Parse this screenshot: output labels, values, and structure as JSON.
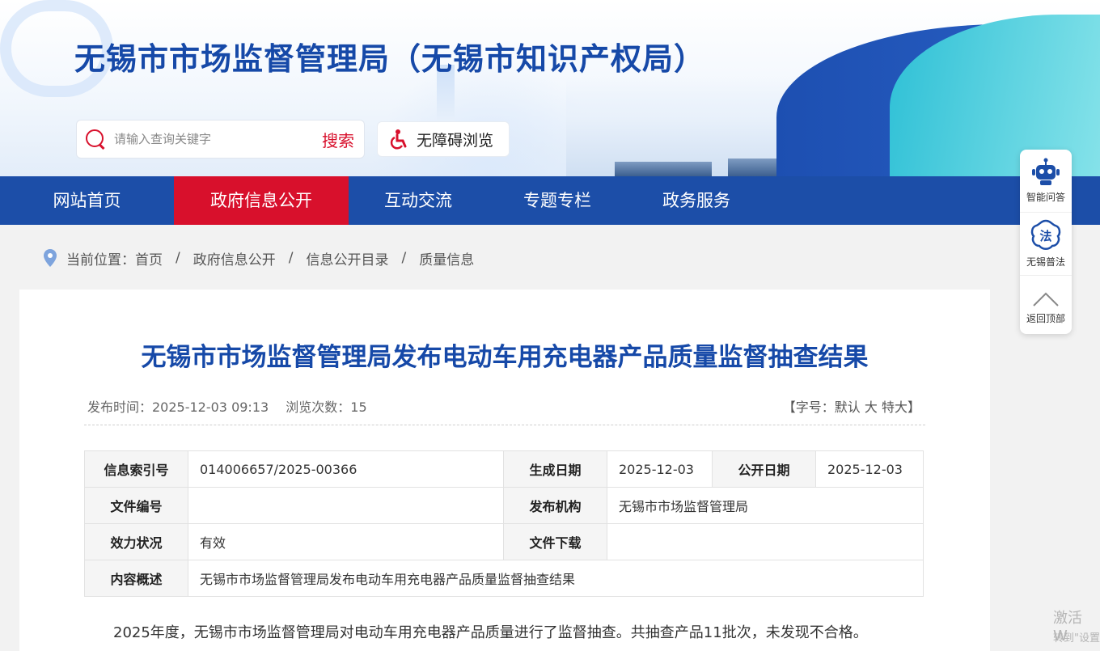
{
  "header": {
    "site_title": "无锡市市场监督管理局（无锡市知识产权局）",
    "search_placeholder": "请输入查询关键字",
    "search_button": "搜索",
    "accessibility_button": "无障碍浏览"
  },
  "nav": {
    "items": [
      {
        "label": "网站首页"
      },
      {
        "label": "政府信息公开"
      },
      {
        "label": "互动交流"
      },
      {
        "label": "专题专栏"
      },
      {
        "label": "政务服务"
      }
    ],
    "active_index": 1
  },
  "breadcrumb": {
    "prefix": "当前位置：",
    "items": [
      "首页",
      "政府信息公开",
      "信息公开目录",
      "质量信息"
    ],
    "separator": "/"
  },
  "article": {
    "title": "无锡市市场监督管理局发布电动车用充电器产品质量监督抽查结果",
    "publish_time": "发布时间：2025-12-03 09:13",
    "view_count": "浏览次数：15",
    "font_size_prefix": "【字号：",
    "font_default": "默认",
    "font_large": "大",
    "font_xlarge": "特大",
    "font_size_suffix": "】",
    "body": "2025年度，无锡市市场监督管理局对电动车用充电器产品质量进行了监督抽查。共抽查产品11批次，未发现不合格。"
  },
  "info_table": {
    "index_label": "信息索引号",
    "index_value": "014006657/2025-00366",
    "gen_date_label": "生成日期",
    "gen_date_value": "2025-12-03",
    "pub_date_label": "公开日期",
    "pub_date_value": "2025-12-03",
    "doc_no_label": "文件编号",
    "doc_no_value": "",
    "publisher_label": "发布机构",
    "publisher_value": "无锡市市场监督管理局",
    "status_label": "效力状况",
    "status_value": "有效",
    "download_label": "文件下载",
    "download_value": "",
    "summary_label": "内容概述",
    "summary_value": "无锡市市场监督管理局发布电动车用充电器产品质量监督抽查结果"
  },
  "float_bar": {
    "items": [
      {
        "label": "智能问答",
        "icon": "robot-icon"
      },
      {
        "label": "无锡普法",
        "icon": "law-icon"
      },
      {
        "label": "返回顶部",
        "icon": "chevron-up-icon"
      }
    ]
  },
  "watermark": {
    "line1": "激活 W",
    "line2": "转到\"设置"
  },
  "colors": {
    "primary_blue": "#1c4ea8",
    "accent_red": "#d8102c",
    "title_blue": "#1649a8"
  }
}
